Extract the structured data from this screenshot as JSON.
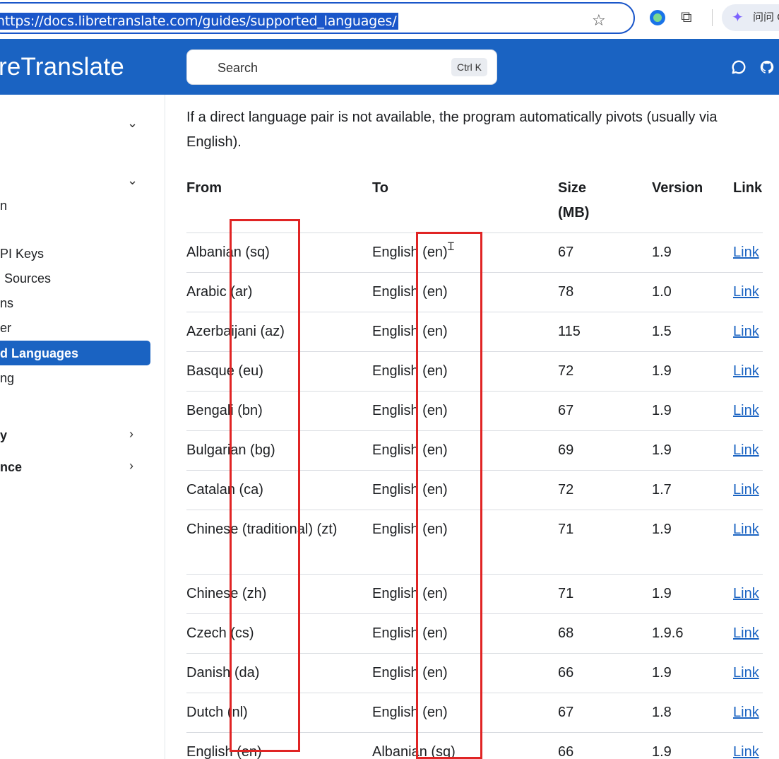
{
  "browser": {
    "url": "https://docs.libretranslate.com/guides/supported_languages/",
    "ask_label": "问问 G"
  },
  "header": {
    "brand": "reTranslate",
    "search_label": "Search",
    "search_shortcut": "Ctrl K",
    "icons": [
      "chat-icon",
      "github-icon"
    ]
  },
  "sidebar": {
    "items": [
      {
        "label": "n"
      },
      {
        "label": "PI Keys"
      },
      {
        "label": "Sources"
      },
      {
        "label": "ns"
      },
      {
        "label": "er"
      },
      {
        "label": "d Languages"
      },
      {
        "label": "ng"
      },
      {
        "label": "y"
      },
      {
        "label": "nce"
      }
    ]
  },
  "main": {
    "intro": "If a direct language pair is not available, the program automatically pivots (usually via English).",
    "columns": [
      "From",
      "To",
      "Size (MB)",
      "Version",
      "Link"
    ],
    "rows": [
      {
        "from": "Albanian (sq)",
        "to": "English (en)",
        "size": "67",
        "version": "1.9",
        "link": "Link"
      },
      {
        "from": "Arabic (ar)",
        "to": "English (en)",
        "size": "78",
        "version": "1.0",
        "link": "Link"
      },
      {
        "from": "Azerbaijani (az)",
        "to": "English (en)",
        "size": "115",
        "version": "1.5",
        "link": "Link"
      },
      {
        "from": "Basque (eu)",
        "to": "English (en)",
        "size": "72",
        "version": "1.9",
        "link": "Link"
      },
      {
        "from": "Bengali (bn)",
        "to": "English (en)",
        "size": "67",
        "version": "1.9",
        "link": "Link"
      },
      {
        "from": "Bulgarian (bg)",
        "to": "English (en)",
        "size": "69",
        "version": "1.9",
        "link": "Link"
      },
      {
        "from": "Catalan (ca)",
        "to": "English (en)",
        "size": "72",
        "version": "1.7",
        "link": "Link"
      },
      {
        "from": "Chinese (traditional) (zt)",
        "to": "English (en)",
        "size": "71",
        "version": "1.9",
        "link": "Link"
      },
      {
        "from": "Chinese (zh)",
        "to": "English (en)",
        "size": "71",
        "version": "1.9",
        "link": "Link"
      },
      {
        "from": "Czech (cs)",
        "to": "English (en)",
        "size": "68",
        "version": "1.9.6",
        "link": "Link"
      },
      {
        "from": "Danish (da)",
        "to": "English (en)",
        "size": "66",
        "version": "1.9",
        "link": "Link"
      },
      {
        "from": "Dutch (nl)",
        "to": "English (en)",
        "size": "67",
        "version": "1.8",
        "link": "Link"
      },
      {
        "from": "English (en)",
        "to": "Albanian (sq)",
        "size": "66",
        "version": "1.9",
        "link": "Link"
      }
    ]
  }
}
